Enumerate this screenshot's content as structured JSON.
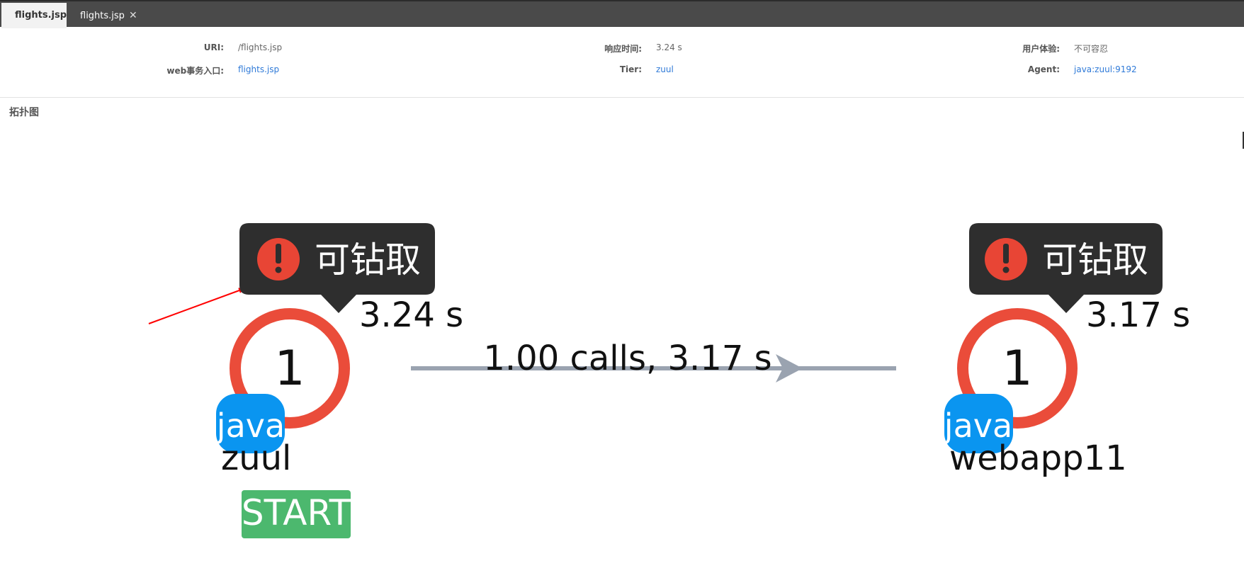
{
  "tabs": [
    {
      "label": "flights.jsp",
      "active": true
    },
    {
      "label": "flights.jsp",
      "active": false,
      "close": "✕"
    }
  ],
  "info": {
    "uri_label": "URI:",
    "uri_value": "/flights.jsp",
    "entry_label": "web事务入口:",
    "entry_value": "flights.jsp",
    "response_label": "响应时间:",
    "response_value": "3.24 s",
    "tier_label": "Tier:",
    "tier_value": "zuul",
    "ux_label": "用户体验:",
    "ux_value": "不可容忍",
    "agent_label": "Agent:",
    "agent_value": "java:zuul:9192"
  },
  "section_title": "拓扑图",
  "topology": {
    "nodes": [
      {
        "count": "1",
        "tooltip": "可钻取",
        "time": "3.24 s",
        "badge": "java",
        "name": "zuul",
        "start_label": "START"
      },
      {
        "count": "1",
        "tooltip": "可钻取",
        "time": "3.17 s",
        "badge": "java",
        "name": "webapp11"
      }
    ],
    "edge": {
      "label": "1.00 calls, 3.17 s"
    }
  },
  "colors": {
    "ring": "#ea4c3a",
    "tooltip_bg": "#2e2e2e",
    "alert": "#e84535",
    "java_badge": "#0a95f0",
    "start_bg": "#4cb86e",
    "edge": "#9aa3b0",
    "annotation_arrow": "#ff0000",
    "link": "#2f7ad8"
  }
}
